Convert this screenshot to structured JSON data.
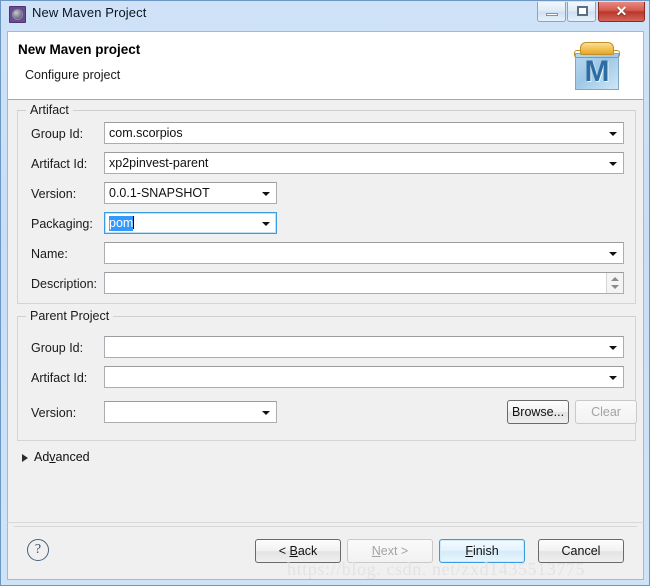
{
  "window": {
    "title": "New Maven Project",
    "icon": "maven-wizard-icon",
    "controls": {
      "minimize": "minimize-icon",
      "maximize": "maximize-icon",
      "close": "✕"
    }
  },
  "banner": {
    "title": "New Maven project",
    "subtitle": "Configure project",
    "icon": "maven-folder-icon",
    "icon_letter": "M"
  },
  "artifact": {
    "legend": "Artifact",
    "fields": [
      {
        "label": "Group Id:",
        "value": "com.scorpios",
        "type": "combo"
      },
      {
        "label": "Artifact Id:",
        "value": "xp2pinvest-parent",
        "type": "combo"
      },
      {
        "label": "Version:",
        "value": "0.0.1-SNAPSHOT",
        "type": "combo"
      },
      {
        "label": "Packaging:",
        "value": "pom",
        "type": "combo"
      },
      {
        "label": "Name:",
        "value": "",
        "type": "combo"
      },
      {
        "label": "Description:",
        "value": "",
        "type": "textarea"
      }
    ]
  },
  "parent_project": {
    "legend": "Parent Project",
    "fields": [
      {
        "label": "Group Id:",
        "value": "",
        "type": "combo"
      },
      {
        "label": "Artifact Id:",
        "value": "",
        "type": "combo"
      },
      {
        "label": "Version:",
        "value": "",
        "type": "combo"
      }
    ],
    "browse_label": "Browse...",
    "clear_label": "Clear"
  },
  "advanced": {
    "label_pre": "Ad",
    "label_mnemonic": "v",
    "label_post": "anced",
    "expanded": false
  },
  "buttons": {
    "help": "?",
    "back_pre": "< ",
    "back_mnemonic": "B",
    "back_post": "ack",
    "next_mnemonic": "N",
    "next_post": "ext >",
    "finish_mnemonic": "F",
    "finish_post": "inish",
    "cancel": "Cancel"
  },
  "watermark": "https://blog. csdn. net/zxd1435513775",
  "colors": {
    "titlebar_gradient_top": "#cfe2f7",
    "selection_blue": "#3399ff",
    "focus_blue": "#3c9bdd",
    "close_red": "#b8362a",
    "content_bg": "#f0f0f0",
    "maven_blue": "#2e6da4",
    "maven_folder_orange": "#f3c04f"
  }
}
